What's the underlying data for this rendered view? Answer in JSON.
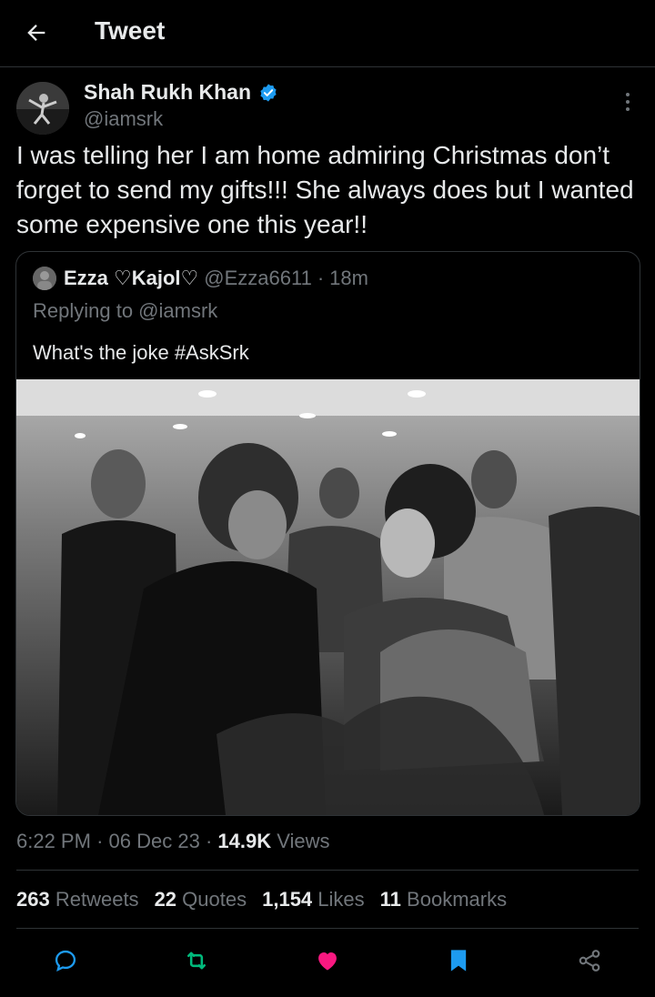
{
  "header": {
    "title": "Tweet"
  },
  "tweet": {
    "author_name": "Shah Rukh Khan",
    "author_handle": "@iamsrk",
    "verified": true,
    "text": "I was telling her I am home admiring Christmas don’t forget to send my gifts!!! She always does but I wanted some expensive one this year!!"
  },
  "quote": {
    "name": "Ezza ♡Kajol♡",
    "handle": "@Ezza6611",
    "separator": "·",
    "time": "18m",
    "replying": "Replying to @iamsrk",
    "text": "What's the joke #AskSrk"
  },
  "meta": {
    "time": "6:22 PM",
    "sep1": "·",
    "date": "06 Dec 23",
    "sep2": "·",
    "views_count": "14.9K",
    "views_label": "Views"
  },
  "stats": {
    "retweets_count": "263",
    "retweets_label": "Retweets",
    "quotes_count": "22",
    "quotes_label": "Quotes",
    "likes_count": "1,154",
    "likes_label": "Likes",
    "bookmarks_count": "11",
    "bookmarks_label": "Bookmarks"
  },
  "colors": {
    "background": "#000000",
    "text": "#e7e9ea",
    "muted": "#71767b",
    "verified": "#1d9bf0",
    "retweet": "#00ba7c",
    "like": "#f91880",
    "bookmark": "#1d9bf0"
  },
  "icons": [
    "back-arrow-icon",
    "verified-badge-icon",
    "more-icon",
    "reply-icon",
    "retweet-icon",
    "like-icon",
    "bookmark-icon",
    "share-icon"
  ]
}
